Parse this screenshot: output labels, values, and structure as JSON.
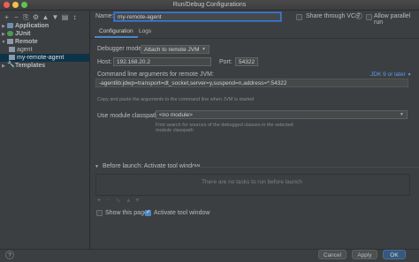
{
  "window": {
    "title": "Run/Debug Configurations"
  },
  "sidebar": {
    "toolbar": [
      "+",
      "−",
      "⎘",
      "⚙",
      "▲",
      "▼",
      "▤",
      "↕"
    ],
    "items": [
      {
        "label": "Application",
        "level": 0,
        "icon": "application-icon",
        "expanded": false
      },
      {
        "label": "JUnit",
        "level": 0,
        "icon": "junit-icon",
        "expanded": false
      },
      {
        "label": "Remote",
        "level": 0,
        "icon": "remote-icon",
        "expanded": true,
        "bold": true
      },
      {
        "label": "agent",
        "level": 1,
        "icon": "remote-config-icon"
      },
      {
        "label": "my-remote-agent",
        "level": 1,
        "icon": "remote-config-icon",
        "selected": true
      },
      {
        "label": "Templates",
        "level": 0,
        "icon": "wrench-icon",
        "expanded": false
      }
    ]
  },
  "header": {
    "name_label": "Name:",
    "name_value": "my-remote-agent",
    "share_label": "Share through VCS",
    "share_help": "?",
    "parallel_label": "Allow parallel run"
  },
  "tabs": [
    "Configuration",
    "Logs"
  ],
  "config": {
    "debugger_mode_label": "Debugger mode:",
    "debugger_mode_value": "Attach to remote JVM",
    "host_label": "Host:",
    "host_value": "192.168.20.2",
    "port_label": "Port:",
    "port_value": "54322",
    "cmd_label": "Command line arguments for remote JVM:",
    "jdk_link": "JDK 9 or later",
    "cmd_value": "-agentlib:jdwp=transport=dt_socket,server=y,suspend=n,address=*:54322",
    "cmd_hint": "Copy and paste the arguments to the command line when JVM is started",
    "module_label": "Use module classpath:",
    "module_value": "<no module>",
    "module_hint": "First search for sources of the debugged classes in the selected module classpath"
  },
  "before_launch": {
    "title": "Before launch: Activate tool window",
    "empty_text": "There are no tasks to run before launch",
    "toolbar": [
      "+",
      "−",
      "✎",
      "▲",
      "▼"
    ]
  },
  "footer": {
    "show_page_label": "Show this page",
    "activate_label": "Activate tool window",
    "help": "?",
    "cancel": "Cancel",
    "apply": "Apply",
    "ok": "OK"
  },
  "colors": {
    "accent": "#4a88c7",
    "selection": "#0d3349",
    "link": "#589df6"
  }
}
